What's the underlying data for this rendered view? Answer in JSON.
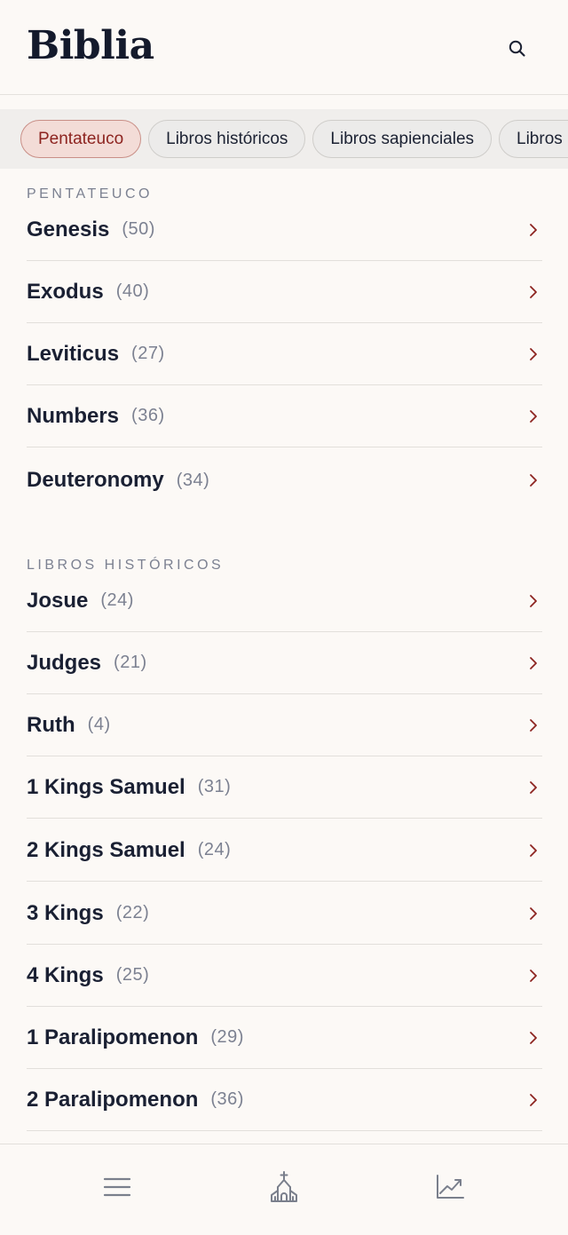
{
  "header": {
    "title": "Biblia",
    "search_icon": "search-icon"
  },
  "chips": [
    {
      "label": "Pentateuco",
      "active": true
    },
    {
      "label": "Libros históricos",
      "active": false
    },
    {
      "label": "Libros sapienciales",
      "active": false
    },
    {
      "label": "Libros proféticos",
      "active": false
    }
  ],
  "sections": [
    {
      "title": "PENTATEUCO",
      "books": [
        {
          "name": "Genesis",
          "count": "(50)"
        },
        {
          "name": "Exodus",
          "count": "(40)"
        },
        {
          "name": "Leviticus",
          "count": "(27)"
        },
        {
          "name": "Numbers",
          "count": "(36)"
        },
        {
          "name": "Deuteronomy",
          "count": "(34)"
        }
      ]
    },
    {
      "title": "LIBROS HISTÓRICOS",
      "books": [
        {
          "name": "Josue",
          "count": "(24)"
        },
        {
          "name": "Judges",
          "count": "(21)"
        },
        {
          "name": "Ruth",
          "count": "(4)"
        },
        {
          "name": "1 Kings Samuel",
          "count": "(31)"
        },
        {
          "name": "2 Kings Samuel",
          "count": "(24)"
        },
        {
          "name": "3 Kings",
          "count": "(22)"
        },
        {
          "name": "4 Kings",
          "count": "(25)"
        },
        {
          "name": "1 Paralipomenon",
          "count": "(29)"
        },
        {
          "name": "2 Paralipomenon",
          "count": "(36)"
        }
      ]
    }
  ],
  "bottom_nav": [
    {
      "icon": "menu-icon"
    },
    {
      "icon": "church-icon"
    },
    {
      "icon": "chart-icon"
    }
  ],
  "colors": {
    "accent": "#8d2420",
    "chip_active_bg": "#f3dcd7",
    "background": "#fcf9f6",
    "text": "#1a2033",
    "muted": "#7c8191"
  }
}
